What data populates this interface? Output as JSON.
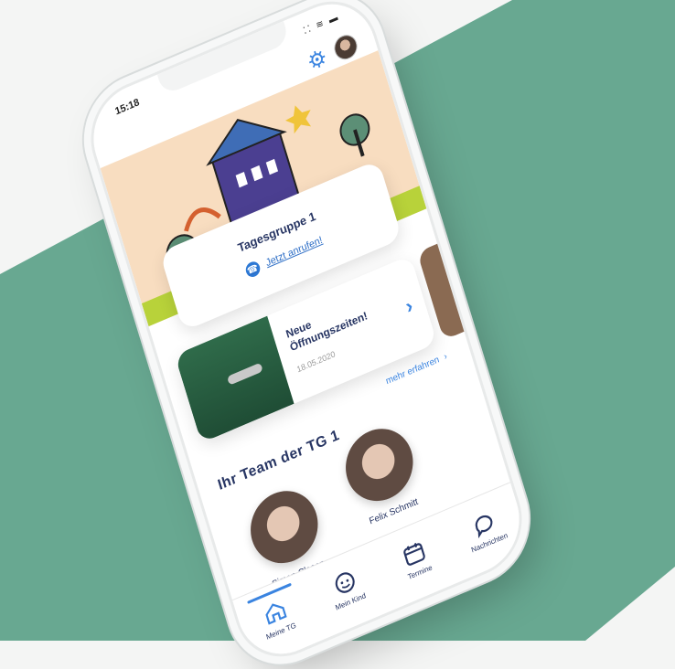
{
  "status_bar": {
    "time": "15:18",
    "icons": "⁚⁚ ≋ ▬"
  },
  "hero": {
    "title": "Tagesgruppe 1",
    "call_label": "Jetzt anrufen!"
  },
  "news": {
    "title": "Neue Öffnungszeiten!",
    "date": "18.05.2020"
  },
  "more_link": {
    "label": "mehr erfahren"
  },
  "team": {
    "title": "Ihr Team der TG 1",
    "members": [
      {
        "name": "Simon Clasen"
      },
      {
        "name": "Felix Schmitt"
      }
    ]
  },
  "tabs": [
    {
      "label": "Meine TG",
      "icon": "house-icon",
      "active": true
    },
    {
      "label": "Mein Kind",
      "icon": "child-face-icon",
      "active": false
    },
    {
      "label": "Termine",
      "icon": "calendar-icon",
      "active": false
    },
    {
      "label": "Nachrichten",
      "icon": "chat-bubble-icon",
      "active": false
    }
  ],
  "colors": {
    "accent": "#3a84e0",
    "text_dark": "#273563",
    "background_band": "#68a891",
    "hero_bg": "#f8ddc0",
    "hero_green": "#b8d23a"
  }
}
